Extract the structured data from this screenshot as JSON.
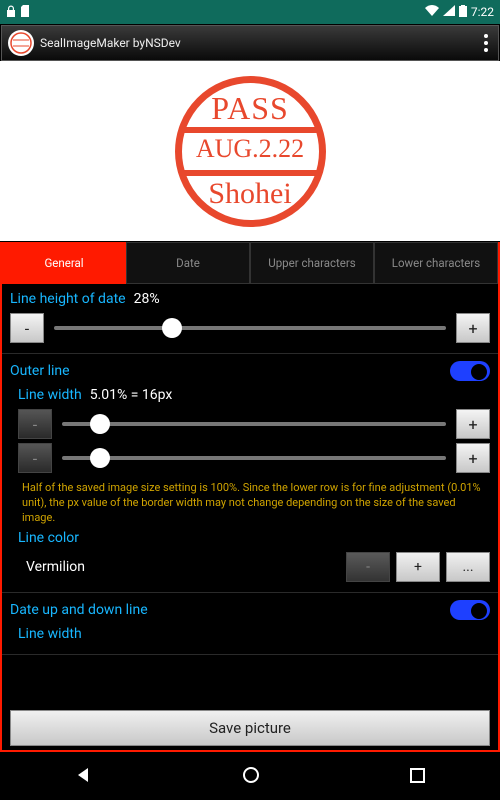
{
  "statusbar": {
    "time": "7:22"
  },
  "appbar": {
    "title": "SealImageMaker byNSDev"
  },
  "seal": {
    "upper": "PASS",
    "date": "AUG.2.22",
    "lower": "Shohei",
    "color": "#e8482d"
  },
  "tabs": [
    "General",
    "Date",
    "Upper characters",
    "Lower characters"
  ],
  "general": {
    "date_height": {
      "label": "Line height of date",
      "value": "28%",
      "thumb_pct": 30
    },
    "outer_line": {
      "label": "Outer line",
      "enabled": true,
      "width": {
        "label": "Line width",
        "value": "5.01% = 16px",
        "thumb1_pct": 10,
        "thumb2_pct": 10
      },
      "help": "Half of the saved image size setting is 100%.\nSince the lower row is for fine adjustment (0.01% unit), the px value of the border width may not change depending on the size of the saved image.",
      "color": {
        "label": "Line color",
        "value": "Vermilion"
      }
    },
    "date_line": {
      "label": "Date up and down line",
      "enabled": true,
      "width_label": "Line width"
    }
  },
  "buttons": {
    "minus": "-",
    "plus": "+",
    "dots": "...",
    "save": "Save picture"
  }
}
